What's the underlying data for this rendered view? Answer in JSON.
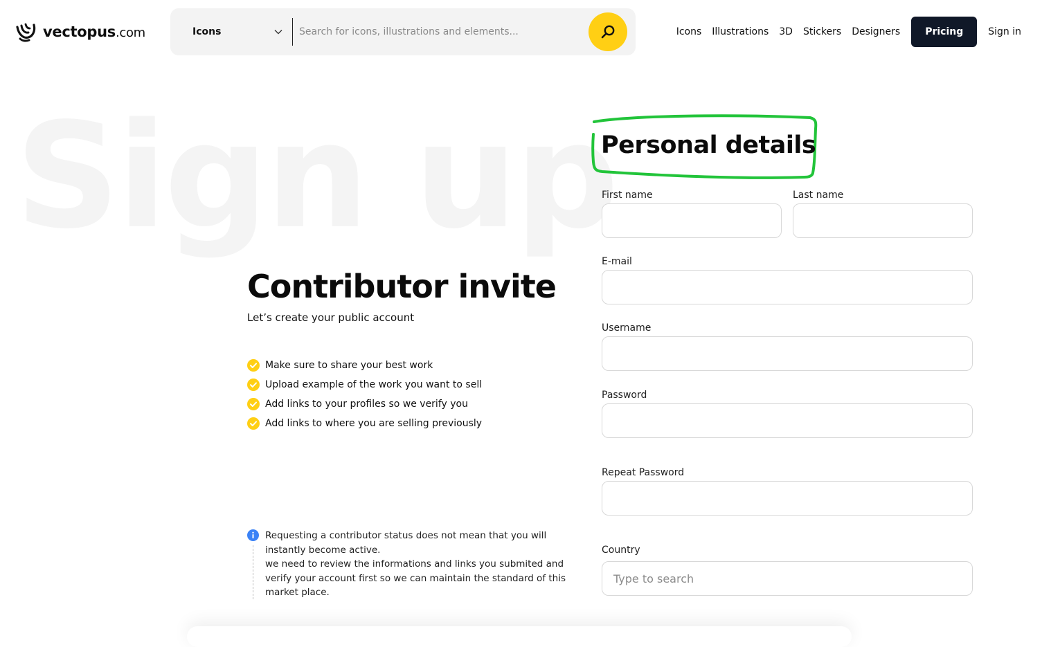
{
  "header": {
    "logo_name": "vectopus",
    "logo_tld": ".com",
    "search_type": "Icons",
    "search_placeholder": "Search for icons, illustrations and elements...",
    "nav": [
      "Icons",
      "Illustrations",
      "3D",
      "Stickers",
      "Designers"
    ],
    "pricing_label": "Pricing",
    "signin_label": "Sign in"
  },
  "background_title": "Sign up",
  "intro": {
    "title": "Contributor invite",
    "subtitle": "Let’s create your public account",
    "checklist": [
      "Make sure to share your best work",
      "Upload example of the work you want to sell",
      "Add links to your profiles so we verify you",
      "Add links to where you are selling previously"
    ]
  },
  "notice": {
    "line1": "Requesting a contributor status does not mean that you will instantly become active.",
    "line2": "we need to review the informations and links you submited and verify your account first so we can maintain the standard of this market place."
  },
  "form": {
    "title": "Personal details",
    "first_name_label": "First name",
    "last_name_label": "Last name",
    "email_label": "E-mail",
    "username_label": "Username",
    "password_label": "Password",
    "repeat_password_label": "Repeat Password",
    "country_label": "Country",
    "country_placeholder": "Type to search"
  },
  "colors": {
    "accent_yellow": "#ffcf14",
    "highlight_green": "#22c43a",
    "dark_button": "#101828",
    "info_blue": "#3b82f6"
  }
}
